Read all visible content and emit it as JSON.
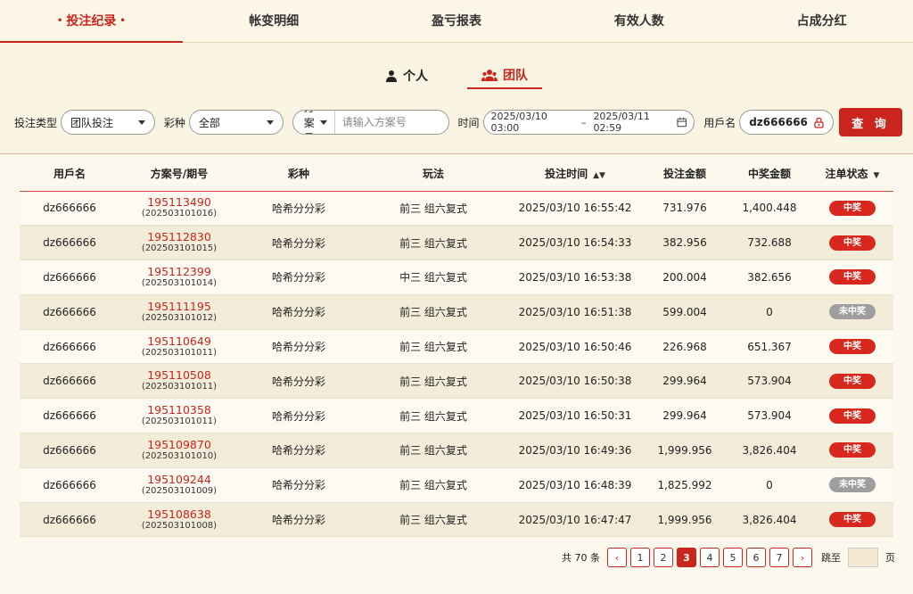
{
  "top_tabs": [
    {
      "label": "投注纪录"
    },
    {
      "label": "帐变明细"
    },
    {
      "label": "盈亏报表"
    },
    {
      "label": "有效人数"
    },
    {
      "label": "占成分红"
    }
  ],
  "sub_toggle": {
    "personal": "个人",
    "team": "团队"
  },
  "filters": {
    "bet_type_label": "投注类型",
    "bet_type_value": "团队投注",
    "lottery_label": "彩种",
    "lottery_value": "全部",
    "scheme_select": "方案号",
    "scheme_placeholder": "请输入方案号",
    "time_label": "时间",
    "date_from": "2025/03/10 03:00",
    "date_sep": "–",
    "date_to": "2025/03/11 02:59",
    "username_label": "用戶名",
    "username_value": "dz666666",
    "search_button": "查 询"
  },
  "table": {
    "headers": [
      "用戶名",
      "方案号/期号",
      "彩种",
      "玩法",
      "投注时间",
      "投注金额",
      "中奖金额",
      "注单状态"
    ],
    "rows": [
      {
        "user": "dz666666",
        "scheme": "195113490",
        "period": "(202503101016)",
        "lottery": "哈希分分彩",
        "play": "前三 组六复式",
        "time": "2025/03/10 16:55:42",
        "bet": "731.976",
        "win": "1,400.448",
        "status": "中奖"
      },
      {
        "user": "dz666666",
        "scheme": "195112830",
        "period": "(202503101015)",
        "lottery": "哈希分分彩",
        "play": "前三 组六复式",
        "time": "2025/03/10 16:54:33",
        "bet": "382.956",
        "win": "732.688",
        "status": "中奖"
      },
      {
        "user": "dz666666",
        "scheme": "195112399",
        "period": "(202503101014)",
        "lottery": "哈希分分彩",
        "play": "中三 组六复式",
        "time": "2025/03/10 16:53:38",
        "bet": "200.004",
        "win": "382.656",
        "status": "中奖"
      },
      {
        "user": "dz666666",
        "scheme": "195111195",
        "period": "(202503101012)",
        "lottery": "哈希分分彩",
        "play": "前三 组六复式",
        "time": "2025/03/10 16:51:38",
        "bet": "599.004",
        "win": "0",
        "status": "未中奖"
      },
      {
        "user": "dz666666",
        "scheme": "195110649",
        "period": "(202503101011)",
        "lottery": "哈希分分彩",
        "play": "前三 组六复式",
        "time": "2025/03/10 16:50:46",
        "bet": "226.968",
        "win": "651.367",
        "status": "中奖"
      },
      {
        "user": "dz666666",
        "scheme": "195110508",
        "period": "(202503101011)",
        "lottery": "哈希分分彩",
        "play": "前三 组六复式",
        "time": "2025/03/10 16:50:38",
        "bet": "299.964",
        "win": "573.904",
        "status": "中奖"
      },
      {
        "user": "dz666666",
        "scheme": "195110358",
        "period": "(202503101011)",
        "lottery": "哈希分分彩",
        "play": "前三 组六复式",
        "time": "2025/03/10 16:50:31",
        "bet": "299.964",
        "win": "573.904",
        "status": "中奖"
      },
      {
        "user": "dz666666",
        "scheme": "195109870",
        "period": "(202503101010)",
        "lottery": "哈希分分彩",
        "play": "前三 组六复式",
        "time": "2025/03/10 16:49:36",
        "bet": "1,999.956",
        "win": "3,826.404",
        "status": "中奖"
      },
      {
        "user": "dz666666",
        "scheme": "195109244",
        "period": "(202503101009)",
        "lottery": "哈希分分彩",
        "play": "前三 组六复式",
        "time": "2025/03/10 16:48:39",
        "bet": "1,825.992",
        "win": "0",
        "status": "未中奖"
      },
      {
        "user": "dz666666",
        "scheme": "195108638",
        "period": "(202503101008)",
        "lottery": "哈希分分彩",
        "play": "前三 组六复式",
        "time": "2025/03/10 16:47:47",
        "bet": "1,999.956",
        "win": "3,826.404",
        "status": "中奖"
      }
    ]
  },
  "pagination": {
    "total_text": "共 70 条",
    "pages": [
      "1",
      "2",
      "3",
      "4",
      "5",
      "6",
      "7"
    ],
    "current": "3",
    "jump_label": "跳至",
    "page_suffix": "页"
  },
  "colors": {
    "accent": "#c9251c",
    "lose_badge": "#9e9e9e",
    "background": "#faf4e2"
  }
}
